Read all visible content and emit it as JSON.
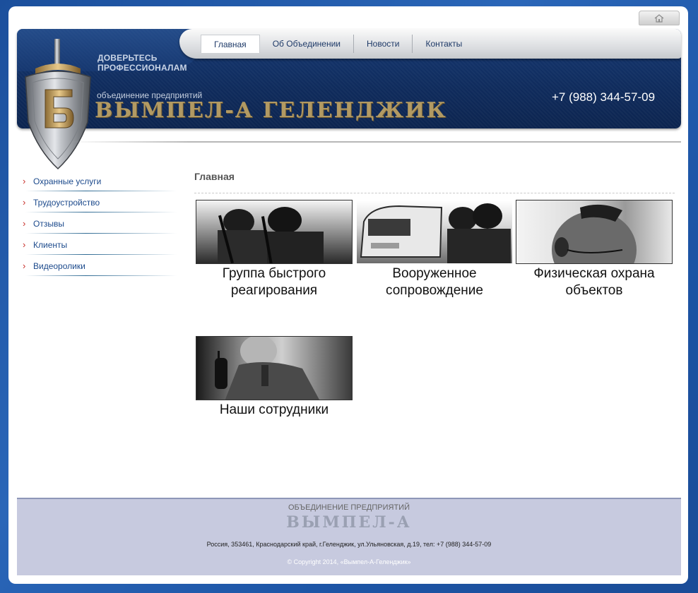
{
  "header": {
    "slogan_line1": "ДОВЕРЬТЕСЬ",
    "slogan_line2": "ПРОФЕССИОНАЛАМ",
    "org_sub": "объединение предприятий",
    "brand": "ВЫМПЕЛ-А ГЕЛЕНДЖИК",
    "phone": "+7 (988) 344-57-09"
  },
  "nav": [
    "Главная",
    "Об Объединении",
    "Новости",
    "Контакты"
  ],
  "sidebar": [
    "Охранные услуги",
    "Трудоустройство",
    "Отзывы",
    "Клиенты",
    "Видеоролики"
  ],
  "main": {
    "title": "Главная",
    "cards": [
      {
        "line1": "Группа быстрого",
        "line2": "реагирования"
      },
      {
        "line1": "Вооруженное",
        "line2": "сопровождение"
      },
      {
        "line1": "Физическая охрана",
        "line2": "объектов"
      },
      {
        "line1": "Наши сотрудники",
        "line2": ""
      }
    ]
  },
  "footer": {
    "sub": "ОБЪЕДИНЕНИЕ ПРЕДПРИЯТИЙ",
    "brand": "ВЫМПЕЛ-А",
    "address": "Россия, 353461, Краснодарский край, г.Геленджик, ул.Ульяновская, д.19, тел: +7 (988) 344-57-09",
    "copyright": "© Copyright 2014, «Вымпел-А-Геленджик»"
  },
  "colors": {
    "background": "#1d55a6",
    "header": "#0f2b5c",
    "brand_gold": "#b29a63",
    "sidebar_link": "#1c4a8c",
    "footer": "#c7cadf"
  },
  "icons": [
    "home-icon",
    "shield-logo-icon",
    "arrow-bullet-icon"
  ]
}
